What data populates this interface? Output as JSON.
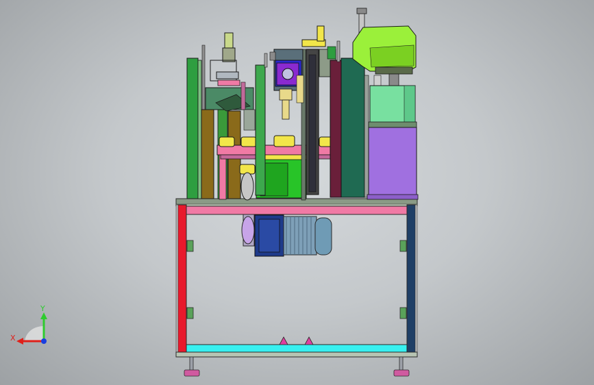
{
  "viewport": {
    "background_top": "#d4d8db",
    "background_edge": "#9da1a4"
  },
  "triad": {
    "x_label": "X",
    "y_label": "Y",
    "x_color": "#e0201a",
    "y_color": "#2ecc2e",
    "z_color": "#1a3ee0"
  },
  "palette": {
    "frame_red": "#e8192c",
    "frame_navy": "#1f3f66",
    "frame_pink": "#f07aa5",
    "frame_cyan": "#38f0f0",
    "robot_lime": "#9bf03a",
    "motor_blue": "#1e3a8a",
    "panel_green": "#2e9e40",
    "housing_purple": "#a070e0"
  }
}
